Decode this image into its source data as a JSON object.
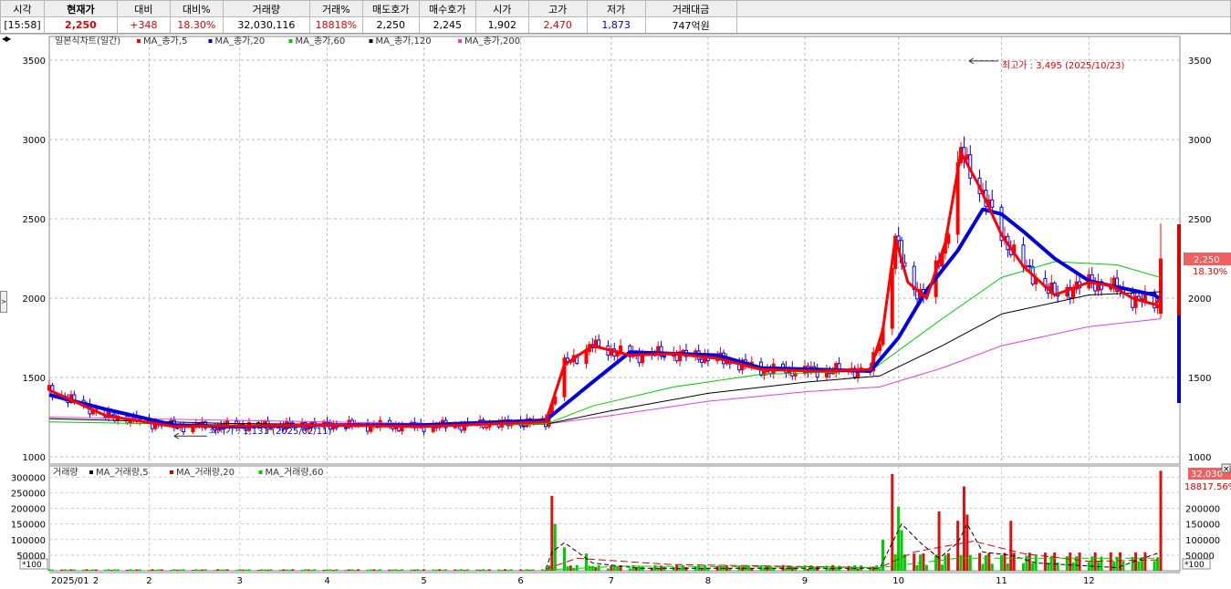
{
  "quote": {
    "headers": [
      "시각",
      "현재가",
      "대비",
      "대비%",
      "거래량",
      "거래%",
      "매도호가",
      "매수호가",
      "시가",
      "고가",
      "저가",
      "거래대금"
    ],
    "values": [
      "[15:58]",
      "2,250",
      "+348",
      "18.30%",
      "32,030,116",
      "18818%",
      "2,250",
      "2,245",
      "1,902",
      "2,470",
      "1,873",
      "747억원"
    ]
  },
  "colors": {
    "up": "#ff0000",
    "down": "#0000ff",
    "ma5": "#ff0000",
    "ma20": "#0000e0",
    "ma60": "#00cc00",
    "ma120": "#000000",
    "ma200": "#e040e0",
    "vol": "#e01010",
    "vol_ma5": "#000000",
    "vol_ma20": "#cc0000",
    "vol_ma60": "#00cc00"
  },
  "legend": {
    "price_title": "일본식차트(일간)",
    "price_items": [
      "MA_종가,5",
      "MA_종가,20",
      "MA_종가,60",
      "MA_종가,120",
      "MA_종가,200"
    ],
    "volume_title": "거래량",
    "volume_items": [
      "MA_거래량,5",
      "MA_거래량,20",
      "MA_거래량,60"
    ]
  },
  "annotations": {
    "high": "최고가 : 3,495 (2025/10/23)",
    "low": "최저가 : 1,131 (2025/02/11)"
  },
  "price_tag": {
    "price": "2,250",
    "change": "18.30%"
  },
  "volume_tag": {
    "volume": "32,030",
    "change": "18817.56%"
  },
  "volume_unit": "*100",
  "x_axis_labels": [
    "2025/01",
    "2",
    "3",
    "4",
    "5",
    "6",
    "7",
    "8",
    "9",
    "10",
    "11",
    "12"
  ],
  "chart_data": [
    {
      "type": "candlestick",
      "title": "일본식차트(일간)",
      "x_range": [
        "2025-01-02",
        "2025-12-24"
      ],
      "ylim": [
        1000,
        3600
      ],
      "y_ticks": [
        1000,
        1500,
        2000,
        2500,
        3000,
        3500
      ],
      "grid": true,
      "series": [
        {
          "name": "MA_종가,5",
          "x": [
            "2025-01-02",
            "2025-01-20",
            "2025-02-11",
            "2025-03-01",
            "2025-04-01",
            "2025-05-01",
            "2025-06-10",
            "2025-06-16",
            "2025-06-25",
            "2025-07-07",
            "2025-07-21",
            "2025-08-04",
            "2025-08-18",
            "2025-09-05",
            "2025-09-22",
            "2025-09-26",
            "2025-09-30",
            "2025-10-04",
            "2025-10-10",
            "2025-10-16",
            "2025-10-21",
            "2025-10-27",
            "2025-11-03",
            "2025-11-10",
            "2025-11-20",
            "2025-12-01",
            "2025-12-08",
            "2025-12-15",
            "2025-12-22",
            "2025-12-24"
          ],
          "values": [
            1420,
            1260,
            1190,
            1195,
            1200,
            1190,
            1220,
            1580,
            1700,
            1640,
            1650,
            1620,
            1550,
            1540,
            1550,
            1800,
            2380,
            2100,
            2000,
            2350,
            2920,
            2700,
            2400,
            2200,
            2020,
            2100,
            2080,
            2000,
            1960,
            2000
          ]
        },
        {
          "name": "MA_종가,20",
          "x": [
            "2025-01-02",
            "2025-01-20",
            "2025-02-11",
            "2025-03-01",
            "2025-04-01",
            "2025-05-01",
            "2025-06-10",
            "2025-06-25",
            "2025-07-07",
            "2025-07-21",
            "2025-08-04",
            "2025-08-18",
            "2025-09-05",
            "2025-09-22",
            "2025-10-01",
            "2025-10-10",
            "2025-10-20",
            "2025-10-28",
            "2025-11-03",
            "2025-11-10",
            "2025-11-20",
            "2025-12-01",
            "2025-12-10",
            "2025-12-22",
            "2025-12-24"
          ],
          "values": [
            1390,
            1300,
            1200,
            1190,
            1200,
            1200,
            1230,
            1470,
            1660,
            1650,
            1640,
            1560,
            1550,
            1540,
            1750,
            2050,
            2300,
            2560,
            2530,
            2420,
            2250,
            2110,
            2070,
            2020,
            1990
          ]
        },
        {
          "name": "MA_종가,60",
          "x": [
            "2025-01-02",
            "2025-03-01",
            "2025-05-01",
            "2025-06-10",
            "2025-06-25",
            "2025-07-21",
            "2025-08-18",
            "2025-09-22",
            "2025-10-15",
            "2025-11-03",
            "2025-11-20",
            "2025-12-10",
            "2025-12-24"
          ],
          "values": [
            1220,
            1200,
            1195,
            1205,
            1320,
            1440,
            1520,
            1540,
            1870,
            2130,
            2230,
            2210,
            2130
          ]
        },
        {
          "name": "MA_종가,120",
          "x": [
            "2025-01-02",
            "2025-03-01",
            "2025-05-01",
            "2025-06-10",
            "2025-07-01",
            "2025-08-01",
            "2025-09-01",
            "2025-09-25",
            "2025-10-15",
            "2025-11-03",
            "2025-12-01",
            "2025-12-24"
          ],
          "values": [
            1240,
            1210,
            1200,
            1205,
            1290,
            1400,
            1470,
            1510,
            1700,
            1900,
            2020,
            2040
          ]
        },
        {
          "name": "MA_종가,200",
          "x": [
            "2025-01-02",
            "2025-03-01",
            "2025-05-01",
            "2025-06-10",
            "2025-07-01",
            "2025-08-01",
            "2025-09-01",
            "2025-09-25",
            "2025-10-15",
            "2025-11-03",
            "2025-12-01",
            "2025-12-24"
          ],
          "values": [
            1250,
            1230,
            1210,
            1205,
            1260,
            1350,
            1410,
            1440,
            1560,
            1700,
            1820,
            1870
          ]
        }
      ],
      "points": [
        {
          "date": "2025-02-11",
          "label": "최저가",
          "value": 1131
        },
        {
          "date": "2025-10-23",
          "label": "최고가",
          "value": 3495
        }
      ]
    },
    {
      "type": "bar",
      "title": "거래량",
      "unit": "*100",
      "ylim": [
        0,
        330000
      ],
      "y_ticks": [
        50000,
        100000,
        150000,
        200000,
        250000,
        300000
      ],
      "bars": [
        {
          "date": "2025-06-12",
          "value": 240000
        },
        {
          "date": "2025-06-13",
          "value": 150000
        },
        {
          "date": "2025-06-16",
          "value": 75000
        },
        {
          "date": "2025-06-23",
          "value": 55000
        },
        {
          "date": "2025-09-26",
          "value": 100000
        },
        {
          "date": "2025-09-29",
          "value": 310000
        },
        {
          "date": "2025-10-01",
          "value": 205000
        },
        {
          "date": "2025-10-02",
          "value": 130000
        },
        {
          "date": "2025-10-14",
          "value": 190000
        },
        {
          "date": "2025-10-20",
          "value": 160000
        },
        {
          "date": "2025-10-22",
          "value": 270000
        },
        {
          "date": "2025-10-23",
          "value": 180000
        },
        {
          "date": "2025-11-06",
          "value": 160000
        },
        {
          "date": "2025-12-24",
          "value": 320301
        }
      ]
    }
  ]
}
